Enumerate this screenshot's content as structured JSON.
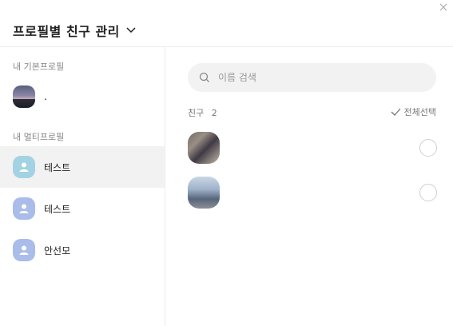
{
  "header": {
    "title": "프로필별 친구 관리"
  },
  "sidebar": {
    "basic_profile_label": "내 기본프로필",
    "basic_profile": {
      "name": "."
    },
    "multi_profile_label": "내 멀티프로필",
    "multi_profiles": [
      {
        "name": "테스트",
        "selected": true
      },
      {
        "name": "테스트",
        "selected": false
      },
      {
        "name": "안선모",
        "selected": false
      }
    ]
  },
  "main": {
    "search": {
      "placeholder": "이름 검색"
    },
    "friends_label": "친구",
    "friends_count": "2",
    "select_all_label": "전체선택",
    "friends": [
      {
        "name": "",
        "checked": false
      },
      {
        "name": "",
        "checked": false
      }
    ]
  },
  "colors": {
    "selected_bg": "#f2f2f2",
    "default_avatar": "#a9bcea",
    "selected_avatar": "#a3d2e4",
    "divider": "#ececec"
  }
}
